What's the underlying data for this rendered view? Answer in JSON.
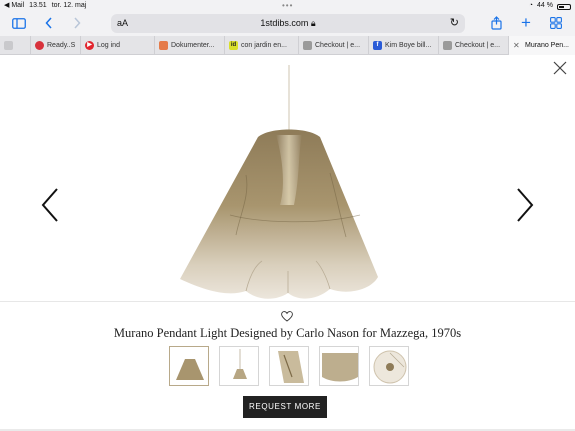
{
  "status_bar": {
    "back_app": "◀ Mail",
    "time": "13.51",
    "date": "tor. 12. maj",
    "battery": "44 %"
  },
  "toolbar": {
    "text_size_label": "aA",
    "url": "1stdibs.com"
  },
  "tabs": [
    {
      "label": "",
      "favicon_color": "#c9c9cc"
    },
    {
      "label": "Ready..S",
      "favicon_color": "#d8323c"
    },
    {
      "label": "Log ind",
      "favicon_color": "#e2262f"
    },
    {
      "label": "Dokumenter...",
      "favicon_color": "#e57b4a"
    },
    {
      "label": "con jardin en...",
      "favicon_color": "#d9e02b"
    },
    {
      "label": "Checkout | e...",
      "favicon_color": "#9a9a9a"
    },
    {
      "label": "Kim Boye bill...",
      "favicon_color": "#2a5bd7"
    },
    {
      "label": "Checkout | e...",
      "favicon_color": "#9a9a9a"
    },
    {
      "label": "Murano Pen...",
      "favicon_color": "#666666"
    }
  ],
  "product": {
    "title": "Murano Pendant Light Designed by Carlo Nason for Mazzega, 1970s",
    "cta": "REQUEST MORE",
    "thumbnail_count": 5,
    "selected_thumbnail": 1
  },
  "colors": {
    "accent": "#1a73e8",
    "cta_bg": "#222222",
    "glass": "#a8956e"
  }
}
